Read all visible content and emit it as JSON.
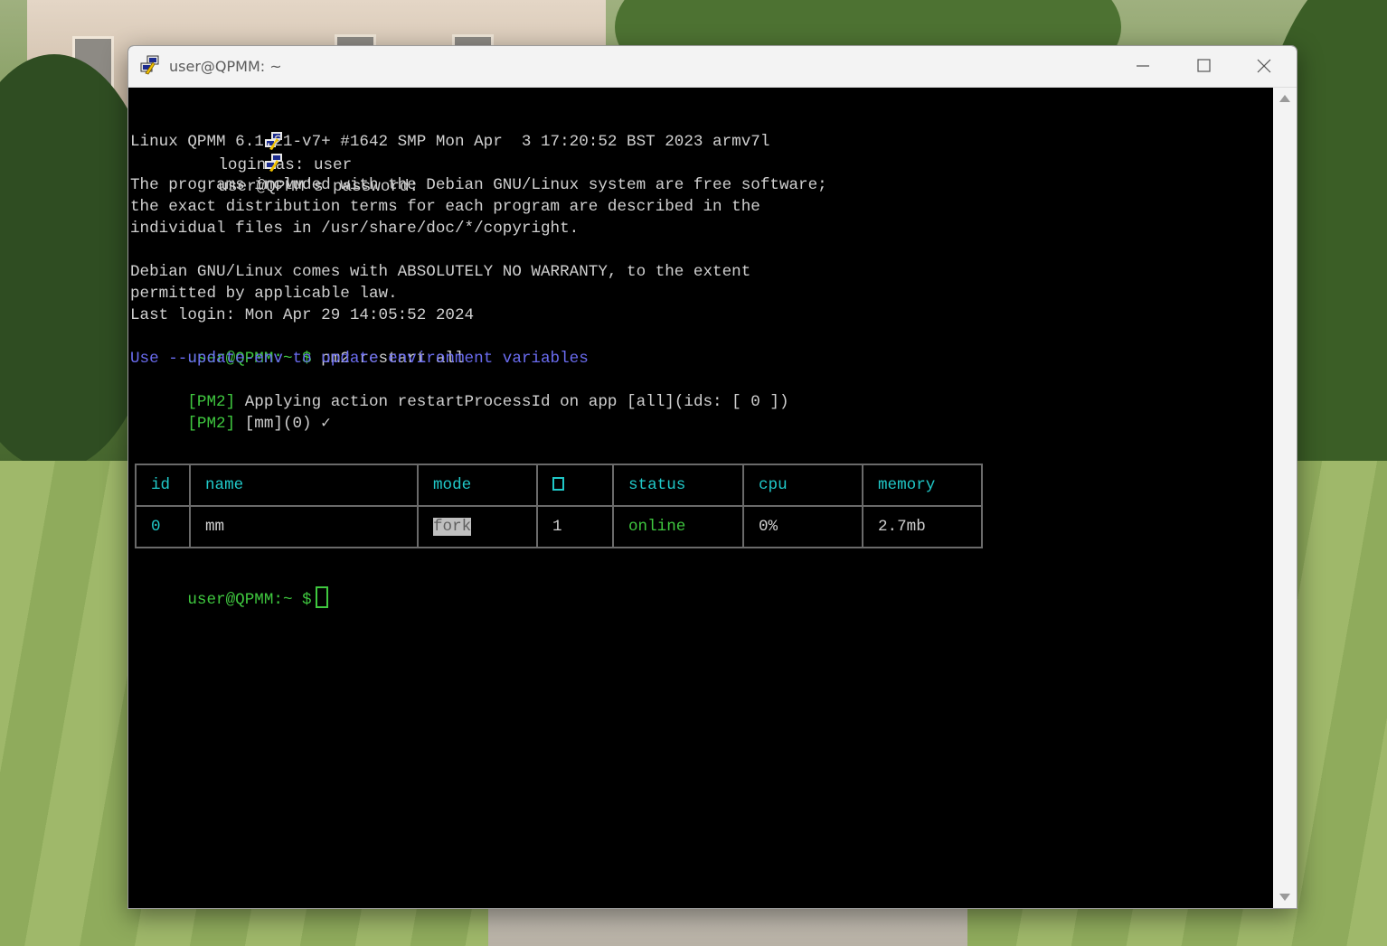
{
  "window": {
    "title": "user@QPMM: ~"
  },
  "terminal": {
    "login_line": "login as: user",
    "password_line": "user@QPMM's password:",
    "kernel_line": "Linux QPMM 6.1.21-v7+ #1642 SMP Mon Apr  3 17:20:52 BST 2023 armv7l",
    "motd1": "The programs included with the Debian GNU/Linux system are free software;",
    "motd2": "the exact distribution terms for each program are described in the",
    "motd3": "individual files in /usr/share/doc/*/copyright.",
    "motd4": "Debian GNU/Linux comes with ABSOLUTELY NO WARRANTY, to the extent",
    "motd5": "permitted by applicable law.",
    "last_login": "Last login: Mon Apr 29 14:05:52 2024",
    "prompt": "user@QPMM:~ $",
    "command": " pm2 restart all",
    "update_env_hint": "Use --update-env to update environment variables",
    "pm2_tag": "[PM2]",
    "pm2_line1": " Applying action restartProcessId on app [all](ids: [ 0 ])",
    "pm2_line2": " [mm](0) ✓",
    "prompt2": "user@QPMM:~ $"
  },
  "pm2_table": {
    "headers": {
      "id": "id",
      "name": "name",
      "mode": "mode",
      "status": "status",
      "cpu": "cpu",
      "memory": "memory"
    },
    "row": {
      "id": "0",
      "name": "mm",
      "mode": "fork",
      "restarts": "1",
      "status": "online",
      "cpu": "0%",
      "memory": "2.7mb"
    }
  },
  "colors": {
    "prompt_green": "#3fc83f",
    "hint_blue": "#6a6cf0",
    "table_header_cyan": "#20c8c8"
  },
  "icons": {
    "app": "putty-icon",
    "minimize": "minimize-icon",
    "maximize": "maximize-icon",
    "close": "close-icon"
  }
}
